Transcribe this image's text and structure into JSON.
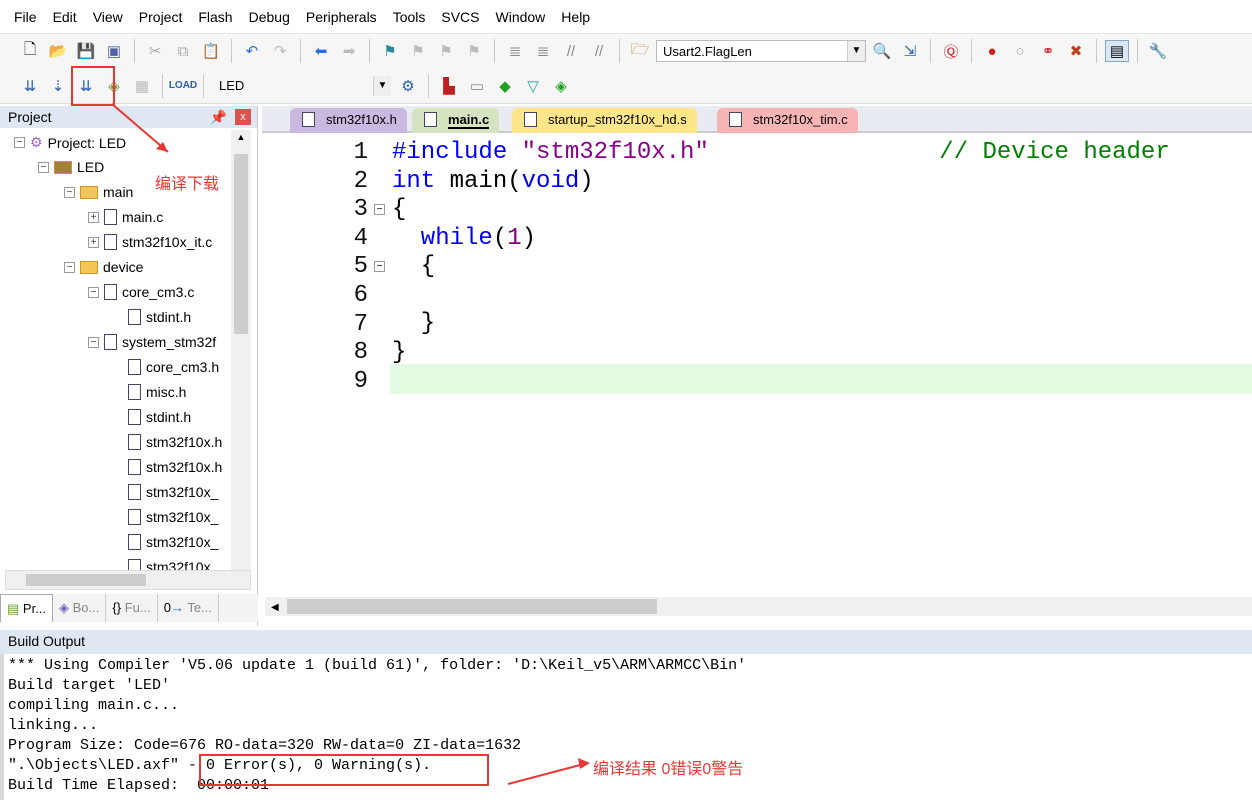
{
  "menu": [
    "File",
    "Edit",
    "View",
    "Project",
    "Flash",
    "Debug",
    "Peripherals",
    "Tools",
    "SVCS",
    "Window",
    "Help"
  ],
  "toolbar1": {
    "find_combo": "Usart2.FlagLen"
  },
  "toolbar2": {
    "target_combo": "LED"
  },
  "project": {
    "title": "Project",
    "tree": [
      {
        "label": "Project: LED",
        "depth": 0,
        "exp": "-"
      },
      {
        "label": "LED",
        "depth": 1,
        "exp": "-"
      },
      {
        "label": "main",
        "depth": 2,
        "exp": "-"
      },
      {
        "label": "main.c",
        "depth": 3,
        "exp": "+"
      },
      {
        "label": "stm32f10x_it.c",
        "depth": 3,
        "exp": "+"
      },
      {
        "label": "device",
        "depth": 2,
        "exp": "-"
      },
      {
        "label": "core_cm3.c",
        "depth": 3,
        "exp": "-"
      },
      {
        "label": "stdint.h",
        "depth": 4,
        "exp": ""
      },
      {
        "label": "system_stm32f",
        "depth": 3,
        "exp": "-"
      },
      {
        "label": "core_cm3.h",
        "depth": 4,
        "exp": ""
      },
      {
        "label": "misc.h",
        "depth": 4,
        "exp": ""
      },
      {
        "label": "stdint.h",
        "depth": 4,
        "exp": ""
      },
      {
        "label": "stm32f10x.h",
        "depth": 4,
        "exp": ""
      },
      {
        "label": "stm32f10x.h",
        "depth": 4,
        "exp": ""
      },
      {
        "label": "stm32f10x_",
        "depth": 4,
        "exp": ""
      },
      {
        "label": "stm32f10x_",
        "depth": 4,
        "exp": ""
      },
      {
        "label": "stm32f10x_",
        "depth": 4,
        "exp": ""
      },
      {
        "label": "stm32f10x_",
        "depth": 4,
        "exp": ""
      }
    ],
    "tabs": [
      "Pr...",
      "Bo...",
      "Fu...",
      "Te..."
    ]
  },
  "editor": {
    "tabs": [
      {
        "label": "stm32f10x.h",
        "color": "#c9b8e0"
      },
      {
        "label": "main.c",
        "color": "#d5e3c0"
      },
      {
        "label": "startup_stm32f10x_hd.s",
        "color": "#fde68a"
      },
      {
        "label": "stm32f10x_tim.c",
        "color": "#f6b4b4"
      }
    ],
    "lines": [
      "1",
      "2",
      "3",
      "4",
      "5",
      "6",
      "7",
      "8",
      "9"
    ],
    "code": {
      "l1a": "#include ",
      "l1b": "\"stm32f10x.h\"",
      "l1c": "// Device header",
      "l2a": "int main(",
      "l2b": "void",
      "l2c": ")",
      "l3": "{",
      "l4a": "  while",
      "l4b": "(",
      "l4c": "1",
      "l4d": ")",
      "l5": "  {",
      "l7": "  }",
      "l8": "}"
    }
  },
  "build_output": {
    "title": "Build Output",
    "lines": [
      "*** Using Compiler 'V5.06 update 1 (build 61)', folder: 'D:\\Keil_v5\\ARM\\ARMCC\\Bin'",
      "Build target 'LED'",
      "compiling main.c...",
      "linking...",
      "Program Size: Code=676 RO-data=320 RW-data=0 ZI-data=1632",
      "\".\\Objects\\LED.axf\" - 0 Error(s), 0 Warning(s).",
      "Build Time Elapsed:  00:00:01"
    ]
  },
  "annotations": {
    "build_download": "编译下载",
    "result": "编译结果 0错误0警告",
    "accent": "#e53935"
  }
}
